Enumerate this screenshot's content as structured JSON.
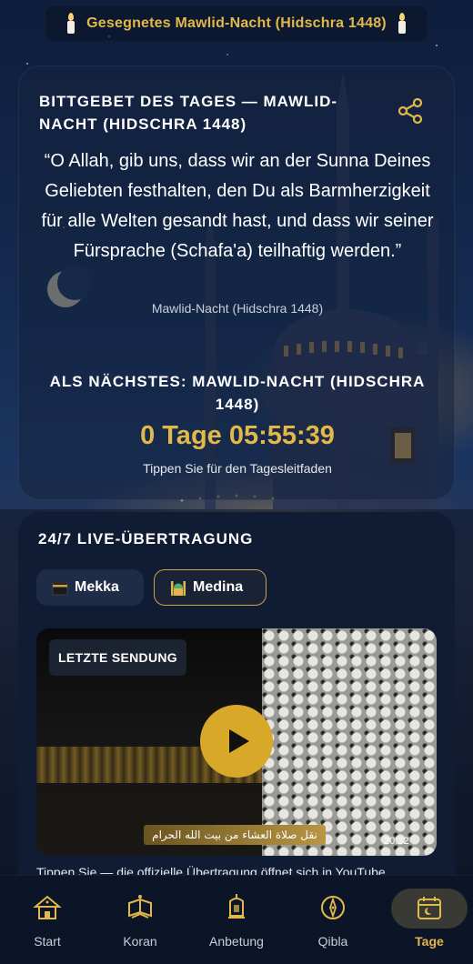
{
  "banner": {
    "title": "Gesegnetes Mawlid-Nacht (Hidschra 1448)",
    "left_icon": "candle-icon",
    "right_icon": "candle-icon"
  },
  "dua_card": {
    "heading": "BITTGEBET DES TAGES — MAWLID-NACHT (HIDSCHRA 1448)",
    "share_icon": "share-icon",
    "text": "“O Allah, gib uns, dass wir an der Sunna Deines Geliebten festhalten, den Du als Barmherzigkeit für alle Welten gesandt hast, und dass wir seiner Fürsprache (Schafa'a) teilhaftig werden.”",
    "source": "Mawlid-Nacht (Hidschra 1448)",
    "next_heading": "ALS NÄCHSTES: MAWLID-NACHT (HIDSCHRA 1448)",
    "countdown": "0 Tage 05:55:39",
    "tap_hint": "Tippen Sie für den Tagesleitfaden"
  },
  "live": {
    "heading": "24/7 LIVE-ÜBERTRAGUNG",
    "tabs": [
      {
        "label": "Mekka",
        "icon": "kaaba-icon",
        "selected": false
      },
      {
        "label": "Medina",
        "icon": "mosque-icon",
        "selected": true
      }
    ],
    "video": {
      "badge": "LETZTE SENDUNG",
      "ticker": "نقل صلاة العشاء من بيت الله الحرام",
      "clock": "20:32",
      "play_icon": "play-icon"
    },
    "hint": "Tippen Sie — die offizielle Übertragung öffnet sich in YouTube"
  },
  "nav": {
    "items": [
      {
        "label": "Start",
        "icon": "home-icon"
      },
      {
        "label": "Koran",
        "icon": "quran-icon"
      },
      {
        "label": "Anbetung",
        "icon": "lantern-icon"
      },
      {
        "label": "Qibla",
        "icon": "compass-icon"
      },
      {
        "label": "Tage",
        "icon": "calendar-icon"
      }
    ],
    "active": "Tage"
  },
  "colors": {
    "accent": "#e3b84a",
    "play": "#d8a928",
    "card_bg": "#101c33"
  }
}
